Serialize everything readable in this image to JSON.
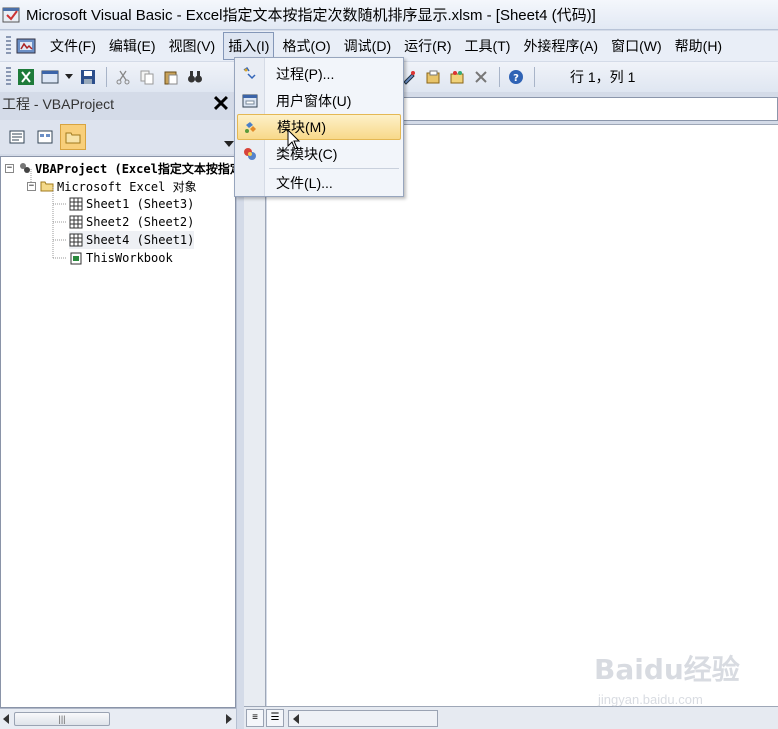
{
  "window": {
    "title": "Microsoft Visual Basic - Excel指定文本按指定次数随机排序显示.xlsm - [Sheet4 (代码)]"
  },
  "menubar": {
    "items": [
      {
        "label": "文件(F)"
      },
      {
        "label": "编辑(E)"
      },
      {
        "label": "视图(V)"
      },
      {
        "label": "插入(I)",
        "active": true
      },
      {
        "label": "格式(O)"
      },
      {
        "label": "调试(D)"
      },
      {
        "label": "运行(R)"
      },
      {
        "label": "工具(T)"
      },
      {
        "label": "外接程序(A)"
      },
      {
        "label": "窗口(W)"
      },
      {
        "label": "帮助(H)"
      }
    ]
  },
  "toolbar": {
    "status": "行 1，列 1"
  },
  "insert_menu": {
    "items": [
      {
        "label": "过程(P)...",
        "icon": "procedure-icon"
      },
      {
        "label": "用户窗体(U)",
        "icon": "userform-icon"
      },
      {
        "label": "模块(M)",
        "icon": "module-icon",
        "highlighted": true
      },
      {
        "label": "类模块(C)",
        "icon": "class-module-icon"
      },
      {
        "label": "文件(L)...",
        "icon": ""
      }
    ]
  },
  "project_panel": {
    "title": "工程 - VBAProject",
    "close_label": "✕",
    "tree": [
      {
        "label": "VBAProject (Excel指定文本按指定次数随机排序显示.xlsm)",
        "level": 0,
        "expander": "−",
        "bold": true
      },
      {
        "label": "Microsoft Excel 对象",
        "level": 1,
        "expander": "−"
      },
      {
        "label": "Sheet1 (Sheet3)",
        "level": 2
      },
      {
        "label": "Sheet2 (Sheet2)",
        "level": 2
      },
      {
        "label": "Sheet4 (Sheet1)",
        "level": 2
      },
      {
        "label": "ThisWorkbook",
        "level": 2
      }
    ]
  },
  "watermark": {
    "main": "Baidu经验",
    "sub": "jingyan.baidu.com"
  },
  "colors": {
    "menu_highlight": "#f8d98a",
    "chrome": "#d4dbe8"
  }
}
